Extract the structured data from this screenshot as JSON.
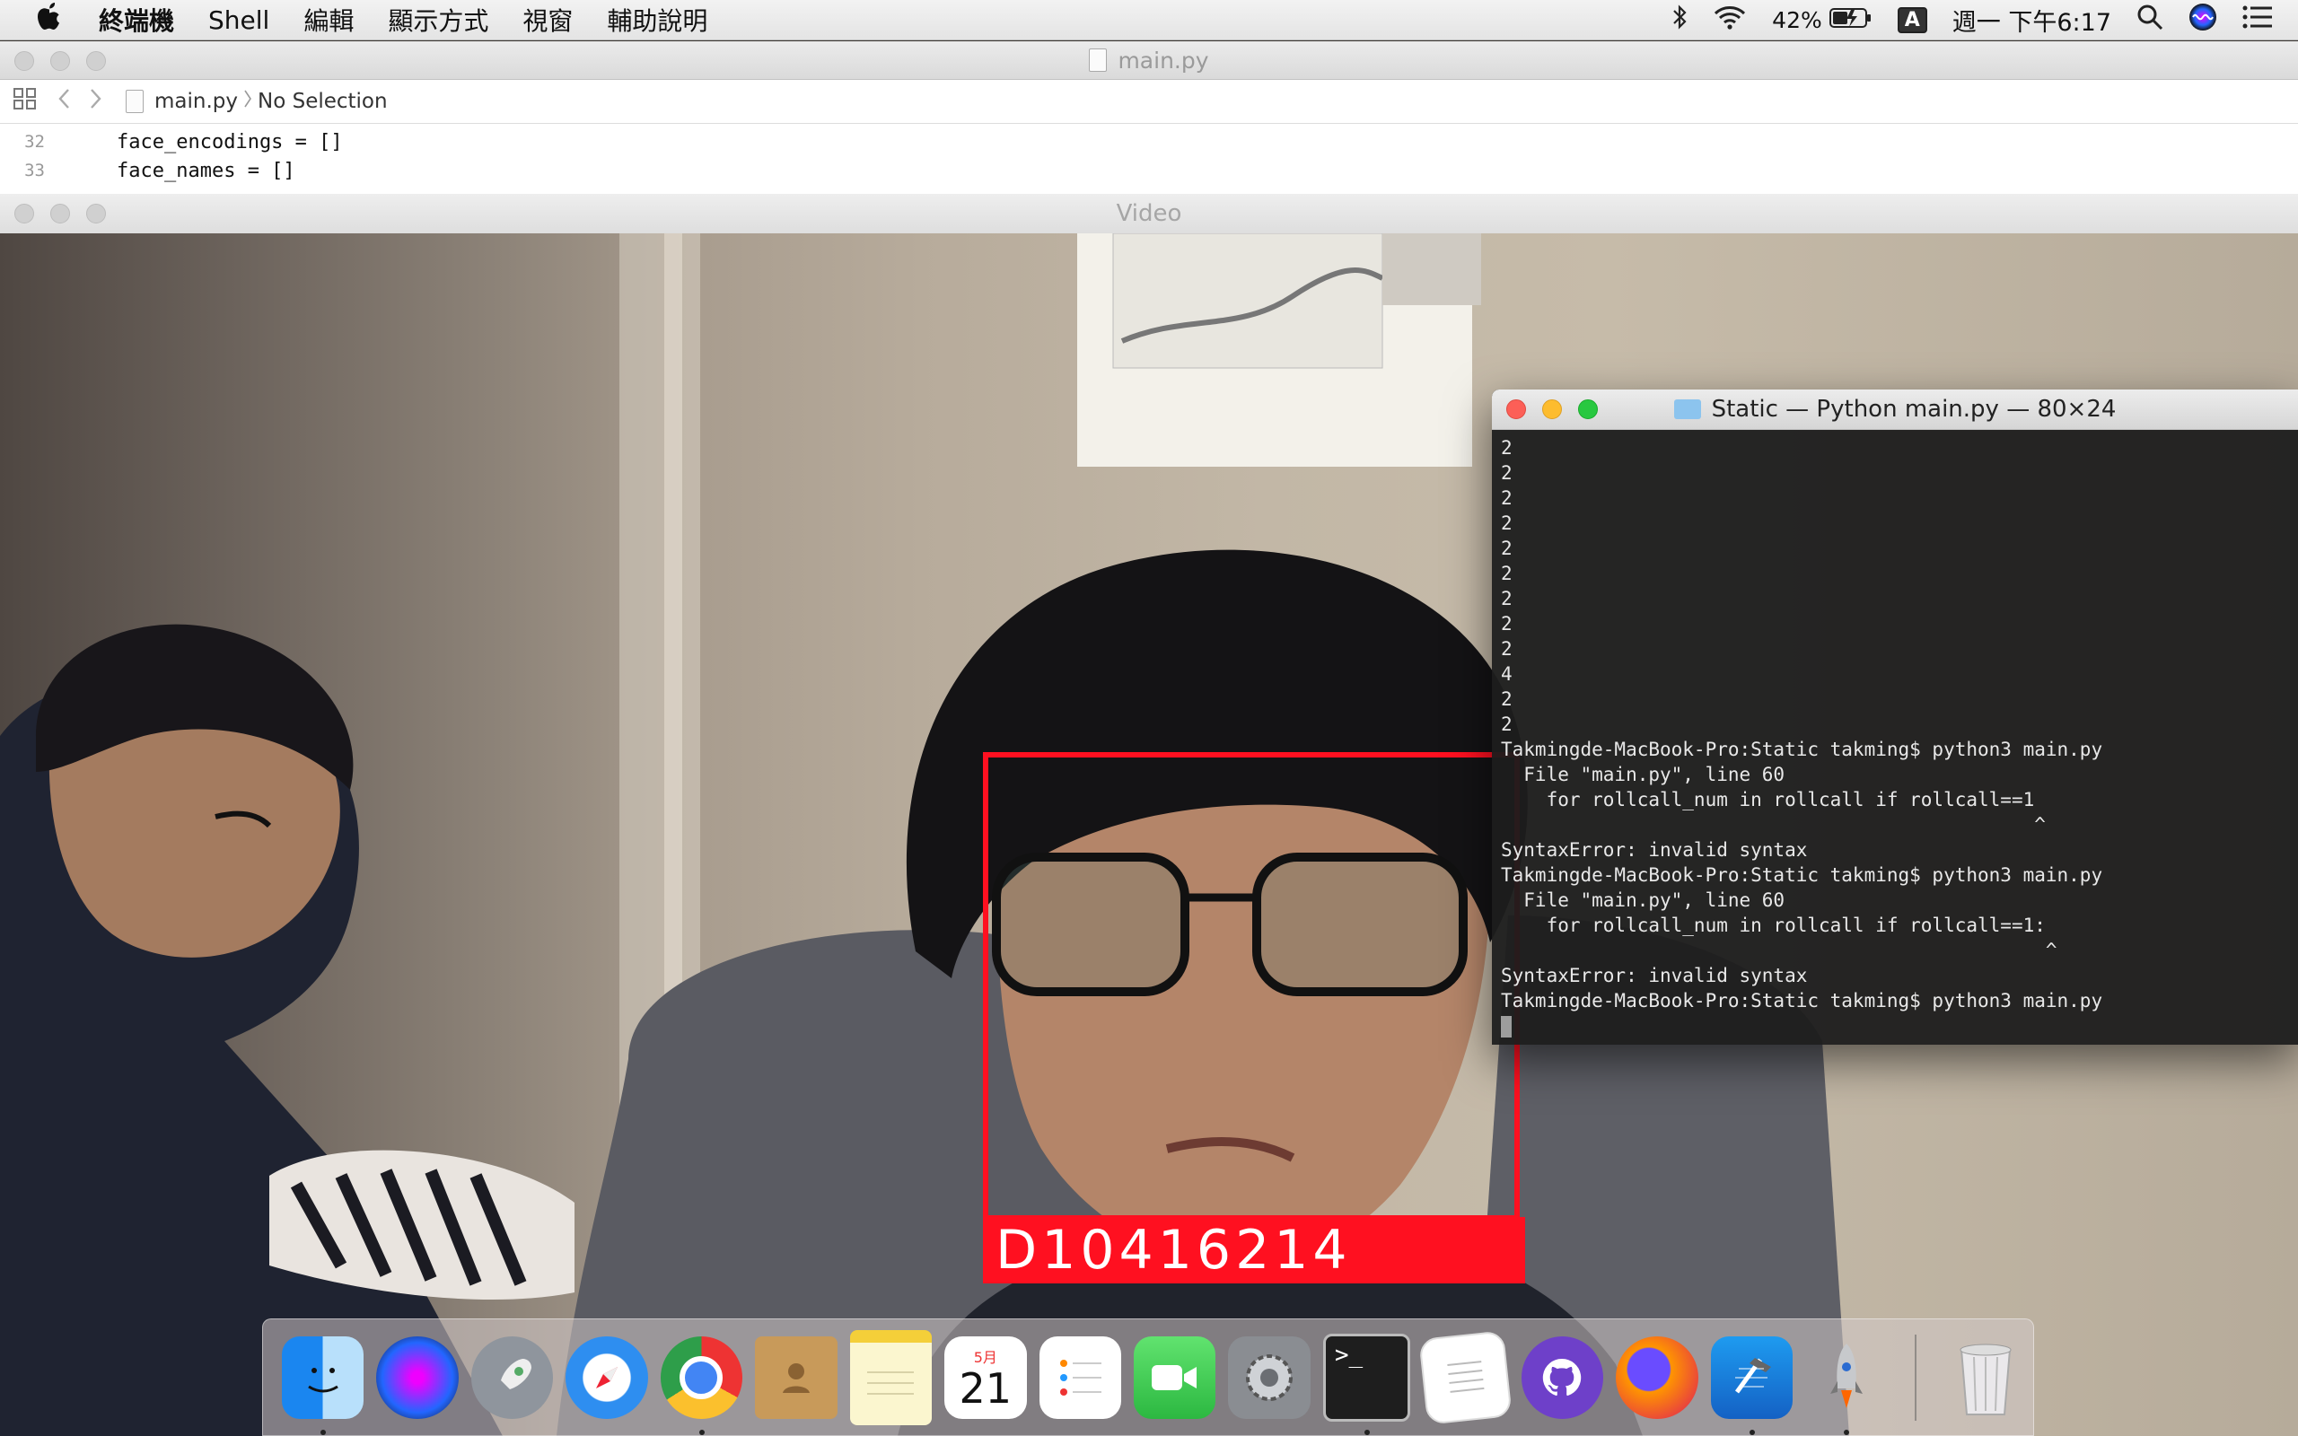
{
  "menubar": {
    "apple_icon": "apple-icon",
    "items": [
      "終端機",
      "Shell",
      "編輯",
      "顯示方式",
      "視窗",
      "輔助說明"
    ],
    "battery_percent": "42%",
    "input_method": "A",
    "clock": "週一 下午6:17"
  },
  "editor": {
    "title": "main.py",
    "breadcrumb_file": "main.py",
    "breadcrumb_selection": "No Selection",
    "lines": [
      {
        "number": "32",
        "code": "face_encodings = []"
      },
      {
        "number": "33",
        "code": "face_names = []"
      }
    ]
  },
  "video": {
    "title": "Video",
    "face_label": "D10416214",
    "box_color": "#ff1020"
  },
  "terminal": {
    "title": "Static — Python main.py — 80×24",
    "lines": [
      "2",
      "2",
      "2",
      "2",
      "2",
      "2",
      "2",
      "2",
      "2",
      "4",
      "2",
      "2",
      "Takmingde-MacBook-Pro:Static takming$ python3 main.py",
      "  File \"main.py\", line 60",
      "    for rollcall_num in rollcall if rollcall==1",
      "                                               ^",
      "SyntaxError: invalid syntax",
      "Takmingde-MacBook-Pro:Static takming$ python3 main.py",
      "  File \"main.py\", line 60",
      "    for rollcall_num in rollcall if rollcall==1:",
      "                                                ^",
      "SyntaxError: invalid syntax",
      "Takmingde-MacBook-Pro:Static takming$ python3 main.py"
    ]
  },
  "dock": {
    "items": [
      {
        "name": "finder-icon",
        "running": true
      },
      {
        "name": "siri-icon",
        "running": false
      },
      {
        "name": "launchpad-icon",
        "running": false
      },
      {
        "name": "safari-icon",
        "running": false
      },
      {
        "name": "chrome-icon",
        "running": true
      },
      {
        "name": "contacts-icon",
        "running": false
      },
      {
        "name": "notes-icon",
        "running": false
      },
      {
        "name": "calendar-icon",
        "running": false,
        "month": "5月",
        "day": "21"
      },
      {
        "name": "reminders-icon",
        "running": false
      },
      {
        "name": "facetime-icon",
        "running": false
      },
      {
        "name": "system-preferences-icon",
        "running": false
      },
      {
        "name": "terminal-icon",
        "running": true
      },
      {
        "name": "textedit-icon",
        "running": false
      },
      {
        "name": "github-desktop-icon",
        "running": false
      },
      {
        "name": "firefox-icon",
        "running": false
      },
      {
        "name": "xcode-icon",
        "running": true
      },
      {
        "name": "rocket-icon",
        "running": true
      },
      {
        "name": "trash-icon",
        "running": false
      }
    ]
  }
}
